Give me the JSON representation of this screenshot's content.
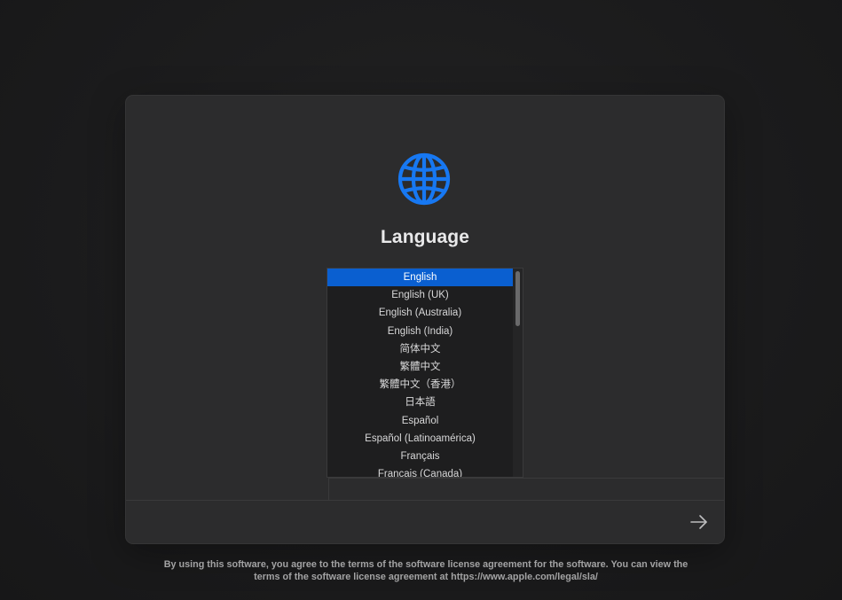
{
  "setup": {
    "title": "Language",
    "languages": [
      "English",
      "English (UK)",
      "English (Australia)",
      "English (India)",
      "简体中文",
      "繁體中文",
      "繁體中文（香港）",
      "日本語",
      "Español",
      "Español (Latinoamérica)",
      "Français",
      "Français (Canada)"
    ],
    "selected_language": "English"
  },
  "icons": {
    "globe": "globe-icon",
    "next": "right-arrow-icon"
  },
  "colors": {
    "accent": "#0a5fd0",
    "globe": "#1778f2"
  },
  "footer": {
    "legal_line_1": "By using this software, you agree to the terms of the software license agreement for the software. You can view the",
    "legal_line_2": "terms of the software license agreement at https://www.apple.com/legal/sla/"
  }
}
